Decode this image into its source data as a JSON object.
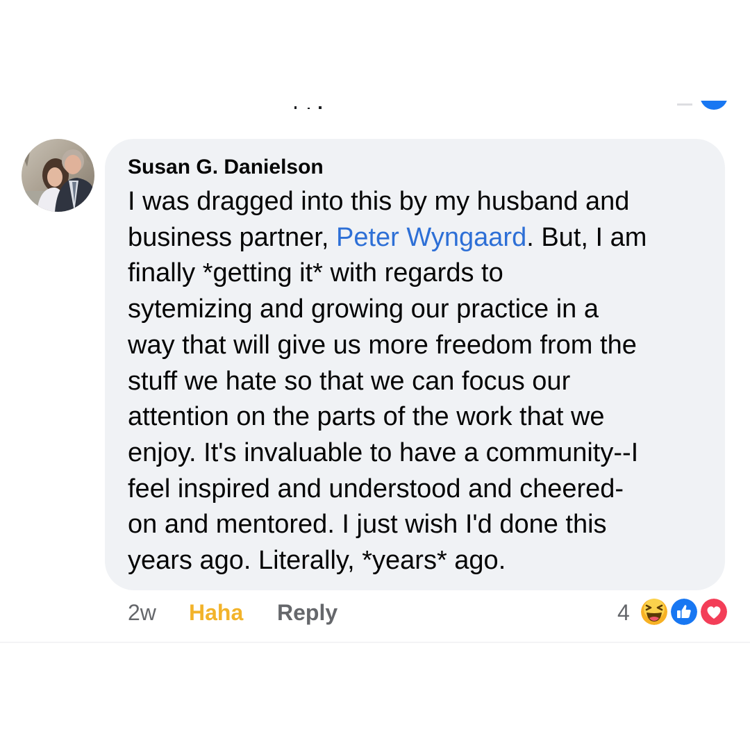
{
  "comment": {
    "author": "Susan G. Danielson",
    "body_lines": [
      {
        "before": "I was dragged into this by my husband and",
        "mention": "",
        "after": ""
      },
      {
        "before": "business partner, ",
        "mention": "Peter Wyngaard",
        "after": ". But, I am"
      },
      {
        "before": "finally *getting it* with regards to",
        "mention": "",
        "after": ""
      },
      {
        "before": "sytemizing and growing our practice in a",
        "mention": "",
        "after": ""
      },
      {
        "before": "way that will give us more freedom from the",
        "mention": "",
        "after": ""
      },
      {
        "before": "stuff we hate so that we can focus our",
        "mention": "",
        "after": ""
      },
      {
        "before": "attention on the parts of the work that we",
        "mention": "",
        "after": ""
      },
      {
        "before": "enjoy. It's invaluable to have a community--I",
        "mention": "",
        "after": ""
      },
      {
        "before": "feel inspired and understood and cheered-",
        "mention": "",
        "after": ""
      },
      {
        "before": "on and mentored. I just wish I'd done this",
        "mention": "",
        "after": ""
      },
      {
        "before": "years ago. Literally, *years* ago.",
        "mention": "",
        "after": ""
      }
    ],
    "mention_color": "#2d6fd6"
  },
  "actions": {
    "timestamp": "2w",
    "reaction_label": "Haha",
    "reaction_color": "#f2b32a",
    "reply_label": "Reply"
  },
  "reactions": {
    "count": "4",
    "icons": [
      "haha-emoji-icon",
      "like-thumb-icon",
      "love-heart-icon"
    ]
  },
  "colors": {
    "bubble": "#f0f2f5",
    "text": "#050505",
    "secondary_text": "#65676b",
    "like_blue": "#1877f2",
    "love_red": "#f33e58"
  }
}
